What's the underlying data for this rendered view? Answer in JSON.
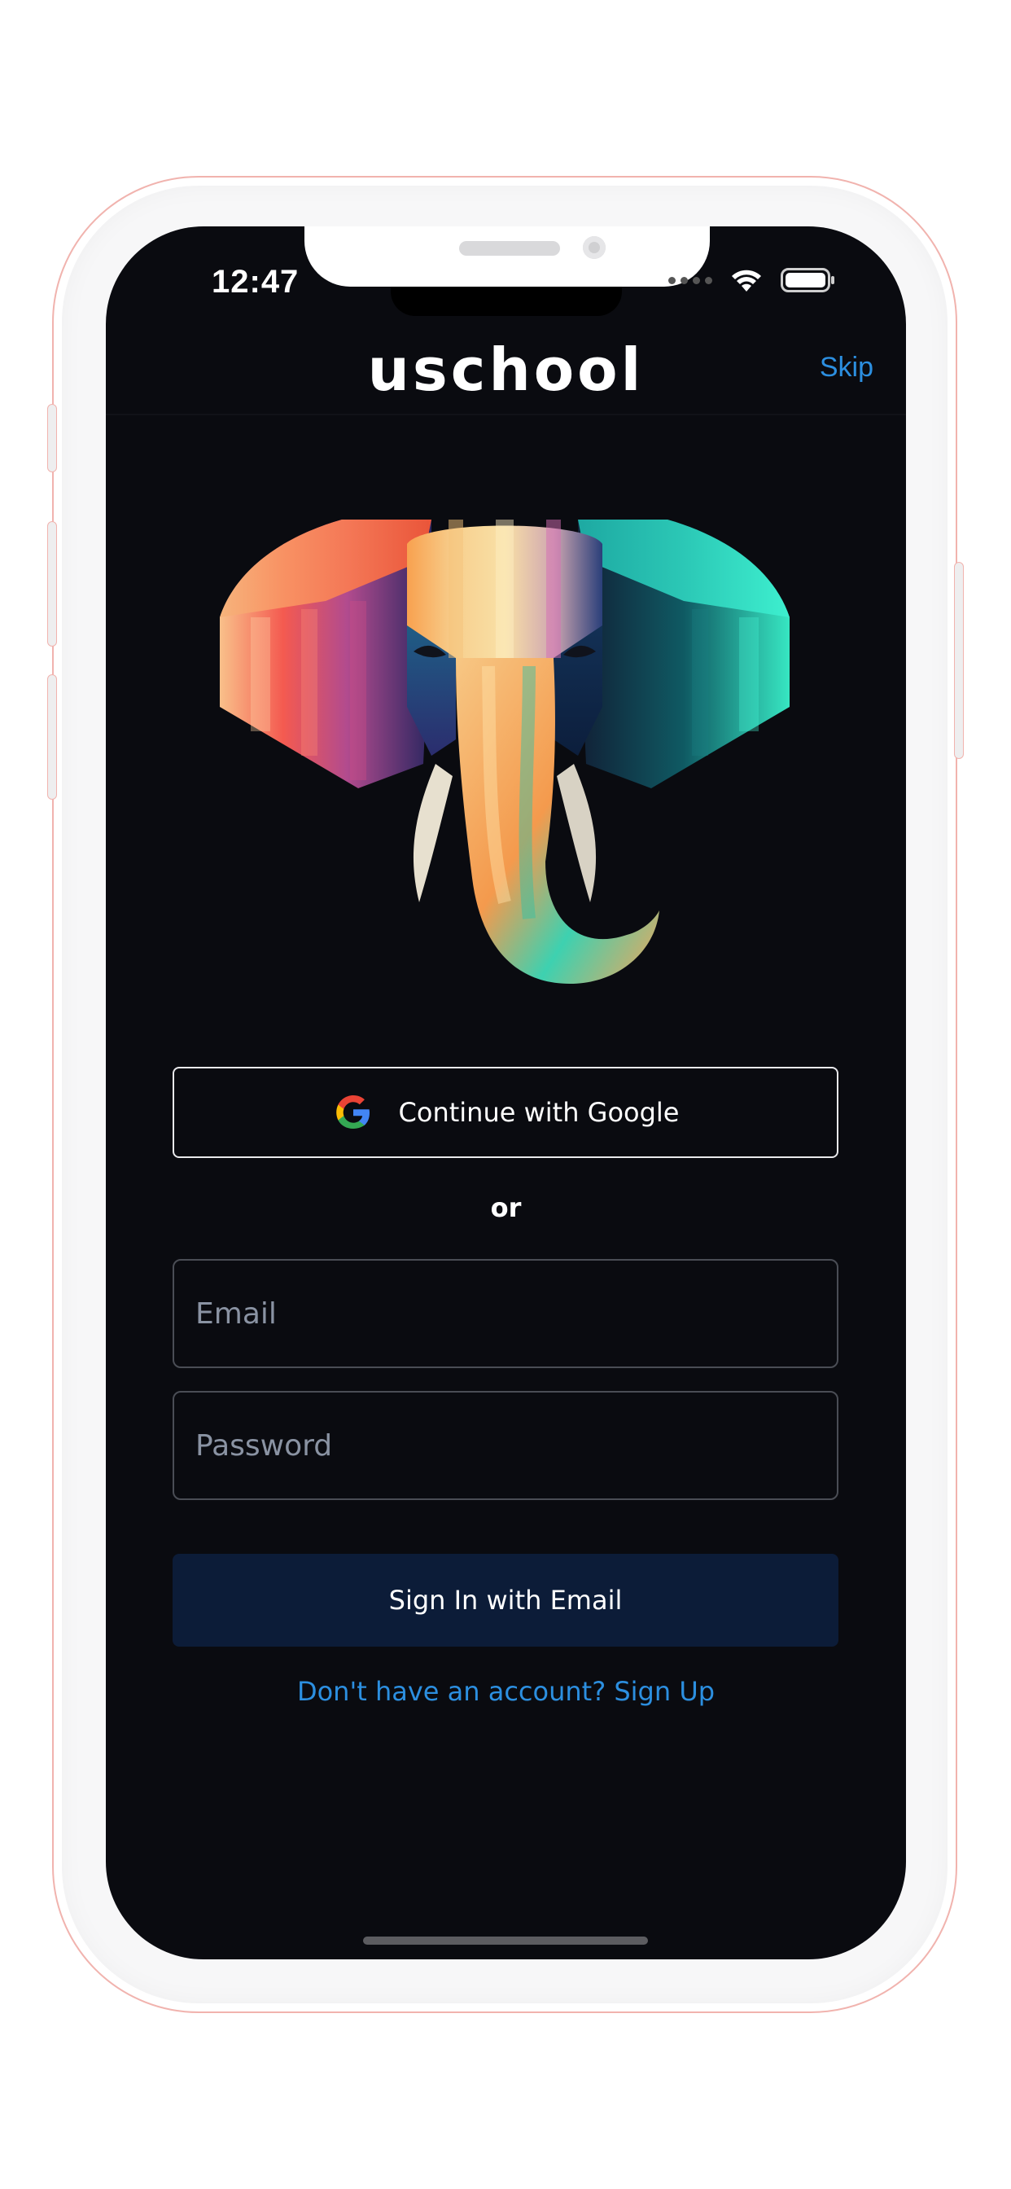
{
  "status_bar": {
    "time": "12:47"
  },
  "header": {
    "logo": "uschool",
    "skip_label": "Skip"
  },
  "auth": {
    "google_label": "Continue with Google",
    "divider": "or",
    "email_placeholder": "Email",
    "email_value": "",
    "password_placeholder": "Password",
    "password_value": "",
    "signin_label": "Sign In with Email",
    "signup_prompt": "Don't have an account? Sign Up"
  },
  "colors": {
    "background": "#0a0b10",
    "accent": "#2c8fe0",
    "signin_button": "#0c1c38"
  },
  "icons": {
    "google": "google-icon",
    "wifi": "wifi-icon",
    "battery": "battery-icon",
    "hero": "elephant-illustration"
  }
}
